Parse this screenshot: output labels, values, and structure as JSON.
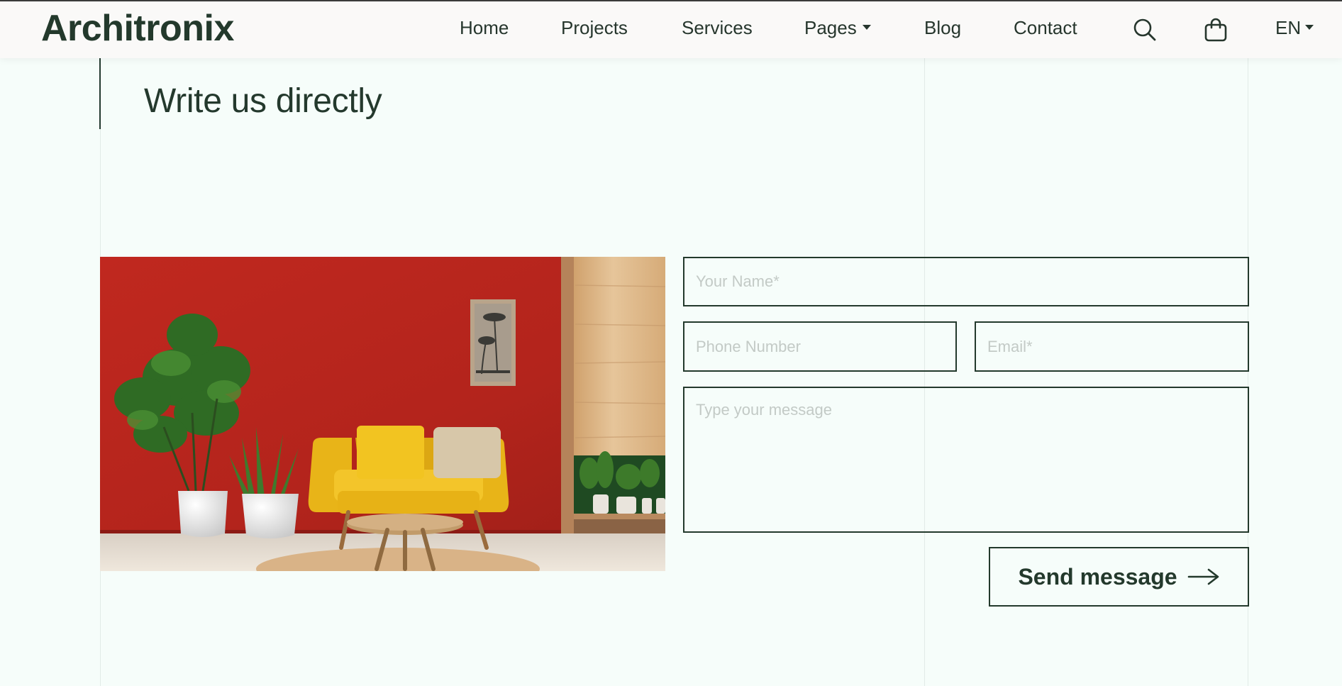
{
  "brand": {
    "name": "Architronix"
  },
  "nav": {
    "items": [
      {
        "label": "Home"
      },
      {
        "label": "Projects"
      },
      {
        "label": "Services"
      },
      {
        "label": "Pages",
        "has_dropdown": true
      },
      {
        "label": "Blog"
      },
      {
        "label": "Contact"
      }
    ],
    "icons": [
      "search-icon",
      "shopping-bag-icon"
    ],
    "language": "EN"
  },
  "contact": {
    "title": "Write us directly",
    "form": {
      "name_placeholder": "Your Name*",
      "phone_placeholder": "Phone Number",
      "email_placeholder": "Email*",
      "message_placeholder": "Type your message",
      "submit_label": "Send message"
    }
  },
  "colors": {
    "page_bg": "#f6fdfa",
    "header_bg": "#faf9f8",
    "text_dark": "#23392c",
    "placeholder": "#c3cac6",
    "image_wall": "#b8251f",
    "sofa": "#f0bf1c"
  }
}
